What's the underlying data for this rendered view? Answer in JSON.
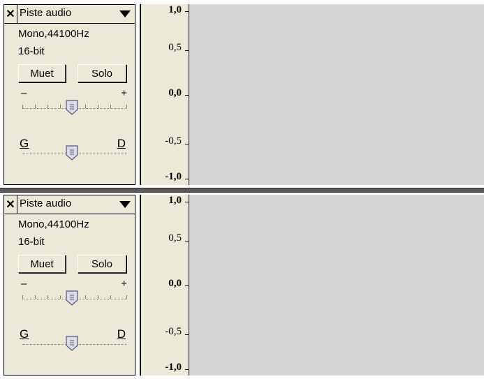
{
  "tracks": [
    {
      "name": "Piste audio",
      "format": "Mono,44100Hz",
      "bits": "16-bit",
      "mute_label": "Muet",
      "solo_label": "Solo",
      "gain": {
        "minus": "–",
        "plus": "+",
        "level": 0.5
      },
      "pan": {
        "left": "G",
        "right": "D",
        "level": 0.5
      },
      "scale": {
        "top": "1,0",
        "upper_mid": "0,5",
        "mid": "0,0",
        "lower_mid": "-0,5",
        "bottom": "-1,0"
      }
    },
    {
      "name": "Piste audio",
      "format": "Mono,44100Hz",
      "bits": "16-bit",
      "mute_label": "Muet",
      "solo_label": "Solo",
      "gain": {
        "minus": "–",
        "plus": "+",
        "level": 0.5
      },
      "pan": {
        "left": "G",
        "right": "D",
        "level": 0.5
      },
      "scale": {
        "top": "1,0",
        "upper_mid": "0,5",
        "mid": "0,0",
        "lower_mid": "-0,5",
        "bottom": "-1,0"
      }
    }
  ],
  "colors": {
    "panel_bg": "#ece9d8",
    "waveform_bg": "#d6d6d6",
    "separator": "#5a5a5a"
  },
  "icons": {
    "close": "close-icon",
    "dropdown": "triangle-down-icon",
    "thumb": "slider-thumb-icon"
  }
}
